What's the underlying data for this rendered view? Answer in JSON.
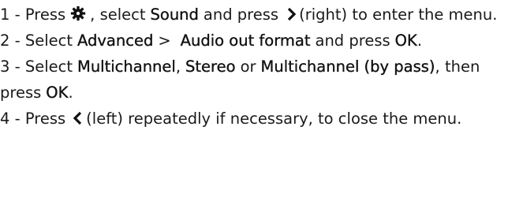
{
  "steps": [
    {
      "a": "1 - Press",
      "b": ", select",
      "c": "Sound",
      "d": "and press",
      "e": "(right) to enter the menu."
    },
    {
      "a": "2 - Select",
      "b": "Advanced",
      "c": ">",
      "d": "Audio out format",
      "e": "and press",
      "f": "OK",
      "g": "."
    },
    {
      "a": "3 - Select",
      "b": "Multichannel",
      "c": ",",
      "d": "Stereo",
      "e": "or",
      "f": "Multichannel (by pass)",
      "g": ", then press",
      "h": "OK",
      "i": "."
    },
    {
      "a": "4 - Press",
      "b": "(left) repeatedly if necessary, to close the menu."
    }
  ],
  "icons": {
    "settings": "gear-icon",
    "right": "chevron-right-icon",
    "left": "chevron-left-icon"
  }
}
